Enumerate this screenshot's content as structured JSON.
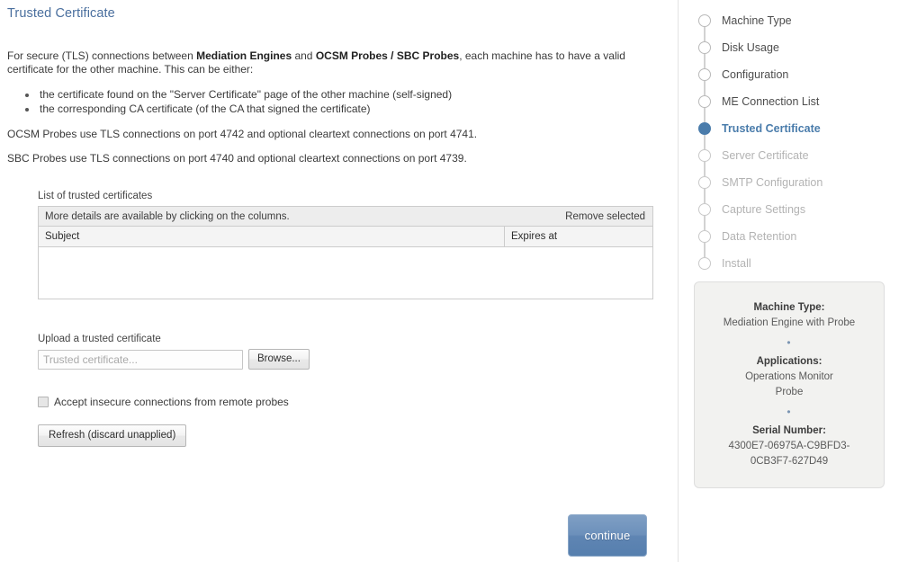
{
  "page": {
    "title": "Trusted Certificate"
  },
  "intro": {
    "lead_before": "For secure (TLS) connections between ",
    "lead_bold1": "Mediation Engines",
    "lead_mid": " and ",
    "lead_bold2": "OCSM Probes / SBC Probes",
    "lead_after": ", each machine has to have a valid certificate for the other machine. This can be either:",
    "bullets": [
      "the certificate found on the \"Server Certificate\" page of the other machine (self-signed)",
      "the corresponding CA certificate (of the CA that signed the certificate)"
    ],
    "note_ocsm": "OCSM Probes use TLS connections on port 4742 and optional cleartext connections on port 4741.",
    "note_sbc": "SBC Probes use TLS connections on port 4740 and optional cleartext connections on port 4739."
  },
  "cert_list": {
    "label": "List of trusted certificates",
    "toolbar_hint": "More details are available by clicking on the columns.",
    "remove_selected": "Remove selected",
    "columns": [
      "Subject",
      "Expires at"
    ],
    "rows": []
  },
  "upload": {
    "label": "Upload a trusted certificate",
    "input_value": "",
    "input_placeholder": "Trusted certificate...",
    "browse_label": "Browse..."
  },
  "insecure": {
    "label": "Accept insecure connections from remote probes",
    "checked": false
  },
  "refresh": {
    "label": "Refresh (discard unapplied)"
  },
  "continue": {
    "label": "continue"
  },
  "steps": [
    {
      "label": "Machine Type",
      "state": "done"
    },
    {
      "label": "Disk Usage",
      "state": "done"
    },
    {
      "label": "Configuration",
      "state": "done"
    },
    {
      "label": "ME Connection List",
      "state": "done"
    },
    {
      "label": "Trusted Certificate",
      "state": "active"
    },
    {
      "label": "Server Certificate",
      "state": "pending"
    },
    {
      "label": "SMTP Configuration",
      "state": "pending"
    },
    {
      "label": "Capture Settings",
      "state": "pending"
    },
    {
      "label": "Data Retention",
      "state": "pending"
    },
    {
      "label": "Install",
      "state": "pending"
    }
  ],
  "info_panel": {
    "machine_type_key": "Machine Type:",
    "machine_type_val": "Mediation Engine with Probe",
    "separator": "•",
    "applications_key": "Applications:",
    "applications_val1": "Operations Monitor",
    "applications_val2": "Probe",
    "serial_key": "Serial Number:",
    "serial_val1": "4300E7-06975A-C9BFD3-",
    "serial_val2": "0CB3F7-627D49"
  },
  "colors": {
    "accent_blue": "#4a7cab",
    "title_blue": "#4a6f9e",
    "panel_bg": "#f2f2f0",
    "toolbar_bg": "#ededed"
  }
}
